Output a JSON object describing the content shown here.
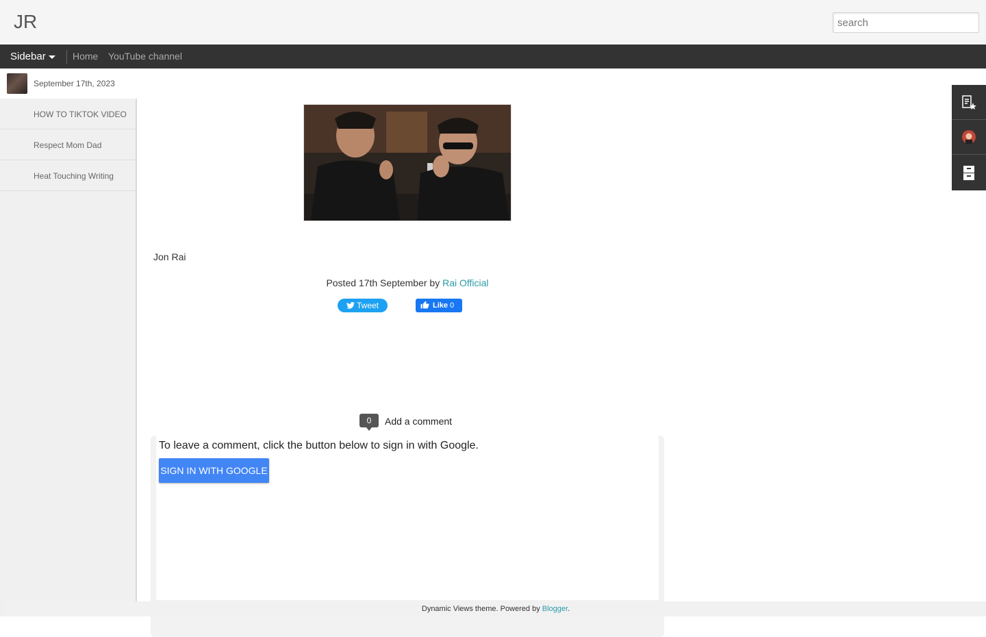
{
  "header": {
    "blog_title": "JR",
    "search_placeholder": "search"
  },
  "nav": {
    "sidebar_label": "Sidebar",
    "links": [
      "Home",
      "YouTube channel"
    ]
  },
  "sidebar": {
    "current": {
      "date": "September 17th, 2023"
    },
    "items": [
      {
        "label": "HOW TO TIKTOK VIDEO"
      },
      {
        "label": "Respect Mom Dad"
      },
      {
        "label": "Heat Touching Writing"
      }
    ]
  },
  "float_icons": [
    "post-star-icon",
    "profile-avatar-icon",
    "archive-icon"
  ],
  "post": {
    "text": "Jon Rai",
    "posted_prefix": "Posted 17th September by ",
    "author": "Rai Official",
    "tweet_label": "Tweet",
    "like_label": "Like",
    "like_count": "0"
  },
  "comments": {
    "count": "0",
    "add_label": "Add a comment",
    "message": "To leave a comment, click the button below to sign in with Google.",
    "signin_label": "SIGN IN WITH GOOGLE"
  },
  "footer": {
    "text": "Dynamic Views theme. Powered by ",
    "link": "Blogger",
    "suffix": "."
  },
  "colors": {
    "navbar": "#333333",
    "link": "#2a9ba8",
    "tweet": "#1da1f2",
    "like": "#1877f2",
    "signin": "#4285f4"
  }
}
